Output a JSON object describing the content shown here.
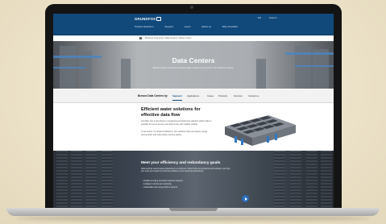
{
  "brand": {
    "logo": "GRUNDFOS"
  },
  "header": {
    "language": "EN",
    "search": "Search",
    "nav": [
      "Product Selection",
      "Support",
      "Learn",
      "About us",
      "Why Grundfos"
    ]
  },
  "breadcrumb": [
    "Business Segments",
    "Data Centers",
    "Data Centers"
  ],
  "hero": {
    "title": "Data Centers",
    "subtitle": "Efficient water solutions that keep data centres running 24/7 with efficient cooling."
  },
  "tabs": {
    "title": "Browse Data Centers by",
    "items": [
      "Segment",
      "Applications",
      "Cases",
      "Products",
      "Services",
      "Contact us"
    ],
    "active_index": 0
  },
  "content": {
    "title": "Efficient water solutions for effective data flow",
    "paragraphs": [
      "Grundfos has a long history in designing and delivering solutions which make it possible for you to secure your data centre with reliable cooling.",
      "In two words: it's all about efficiency. Our solutions help you reduce energy consumption and costs while ensuring uptime."
    ]
  },
  "band": {
    "title": "Meet your efficiency and redundancy goals",
    "paragraph": "Data centres need to keep downtime to a minimum. Here's how our products and solutions can help you meet your goals by improving efficiency and reducing redundancy.",
    "list": [
      "Reliable pumping and water treatment solutions",
      "Intelligent controls and monitoring",
      "Sustainable and energy efficient systems"
    ]
  },
  "colors": {
    "header": "#11497b",
    "accent": "#2a6ebd",
    "page_bg": "#eee4cd"
  }
}
